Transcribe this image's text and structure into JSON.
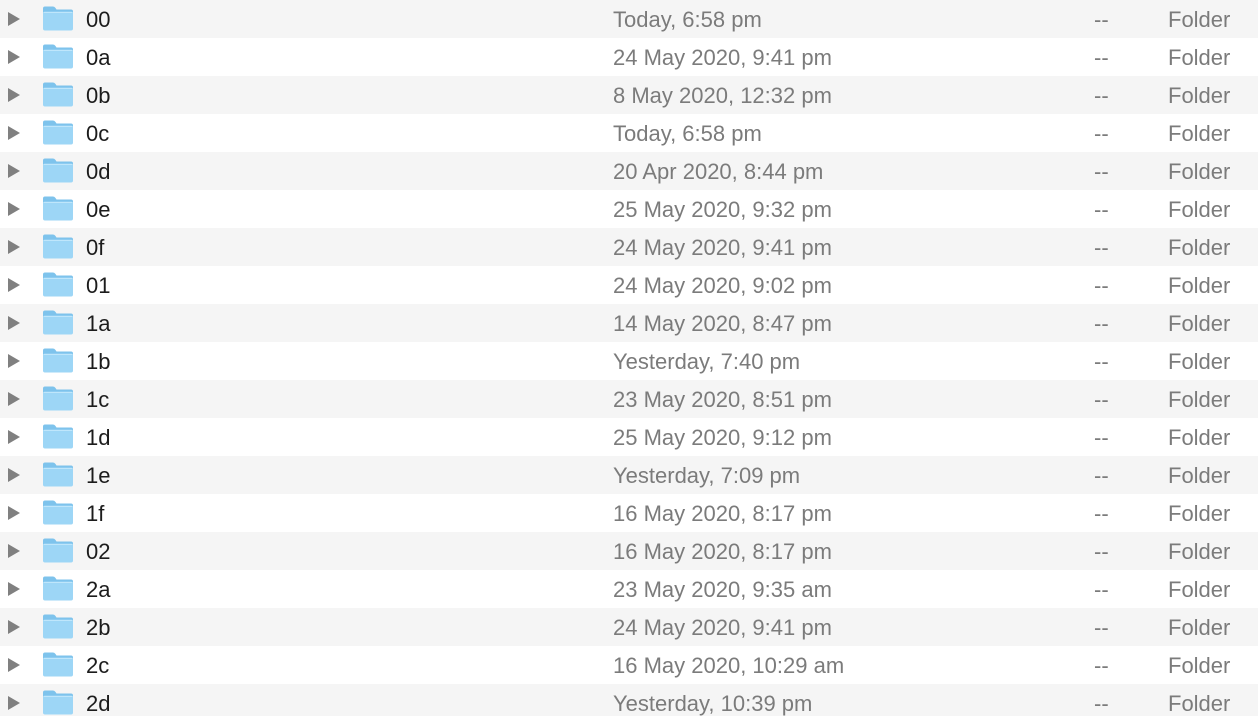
{
  "colors": {
    "row_alt": "#f5f5f5",
    "row_even": "#ffffff",
    "folder_back": "#7ec3ec",
    "folder_front": "#9dd6f6",
    "text_primary": "#1c1c1c",
    "text_secondary": "#7b7b7b",
    "disclosure": "#808080"
  },
  "icons": {
    "disclosure": "disclosure-triangle-icon",
    "folder": "folder-icon"
  },
  "rows": [
    {
      "name": "00",
      "date": "Today, 6:58 pm",
      "size": "--",
      "kind": "Folder"
    },
    {
      "name": "0a",
      "date": "24 May 2020, 9:41 pm",
      "size": "--",
      "kind": "Folder"
    },
    {
      "name": "0b",
      "date": "8 May 2020, 12:32 pm",
      "size": "--",
      "kind": "Folder"
    },
    {
      "name": "0c",
      "date": "Today, 6:58 pm",
      "size": "--",
      "kind": "Folder"
    },
    {
      "name": "0d",
      "date": "20 Apr 2020, 8:44 pm",
      "size": "--",
      "kind": "Folder"
    },
    {
      "name": "0e",
      "date": "25 May 2020, 9:32 pm",
      "size": "--",
      "kind": "Folder"
    },
    {
      "name": "0f",
      "date": "24 May 2020, 9:41 pm",
      "size": "--",
      "kind": "Folder"
    },
    {
      "name": "01",
      "date": "24 May 2020, 9:02 pm",
      "size": "--",
      "kind": "Folder"
    },
    {
      "name": "1a",
      "date": "14 May 2020, 8:47 pm",
      "size": "--",
      "kind": "Folder"
    },
    {
      "name": "1b",
      "date": "Yesterday, 7:40 pm",
      "size": "--",
      "kind": "Folder"
    },
    {
      "name": "1c",
      "date": "23 May 2020, 8:51 pm",
      "size": "--",
      "kind": "Folder"
    },
    {
      "name": "1d",
      "date": "25 May 2020, 9:12 pm",
      "size": "--",
      "kind": "Folder"
    },
    {
      "name": "1e",
      "date": "Yesterday, 7:09 pm",
      "size": "--",
      "kind": "Folder"
    },
    {
      "name": "1f",
      "date": "16 May 2020, 8:17 pm",
      "size": "--",
      "kind": "Folder"
    },
    {
      "name": "02",
      "date": "16 May 2020, 8:17 pm",
      "size": "--",
      "kind": "Folder"
    },
    {
      "name": "2a",
      "date": "23 May 2020, 9:35 am",
      "size": "--",
      "kind": "Folder"
    },
    {
      "name": "2b",
      "date": "24 May 2020, 9:41 pm",
      "size": "--",
      "kind": "Folder"
    },
    {
      "name": "2c",
      "date": "16 May 2020, 10:29 am",
      "size": "--",
      "kind": "Folder"
    },
    {
      "name": "2d",
      "date": "Yesterday, 10:39 pm",
      "size": "--",
      "kind": "Folder"
    }
  ]
}
